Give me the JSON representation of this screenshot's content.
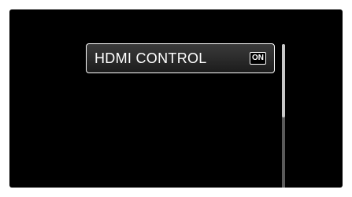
{
  "menu": {
    "items": [
      {
        "label": "HDMI CONTROL",
        "value": "ON",
        "selected": true
      }
    ]
  },
  "scrollbar": {
    "visible_fraction": 0.5,
    "position_fraction": 0.0
  },
  "colors": {
    "background": "#000000",
    "text": "#ffffff",
    "highlight_border": "#ffffff"
  }
}
